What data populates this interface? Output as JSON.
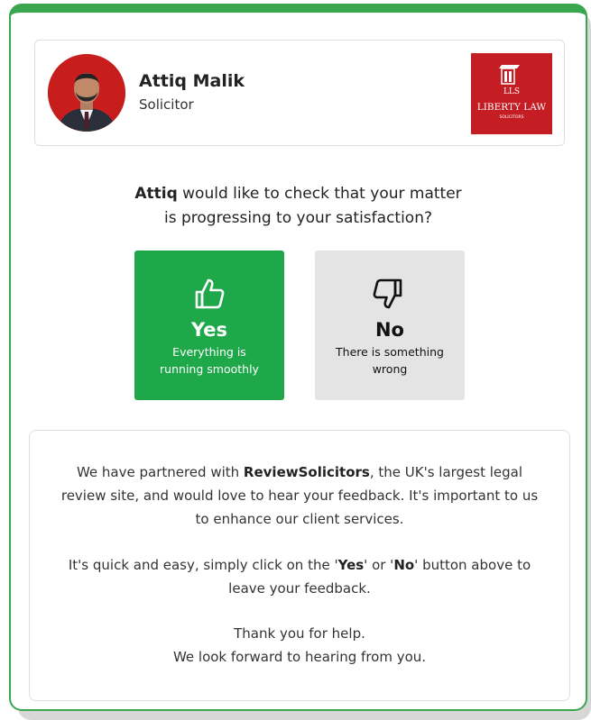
{
  "profile": {
    "name": "Attiq Malik",
    "role": "Solicitor",
    "avatar_icon": "person-photo",
    "logo": {
      "monogram": "LLS",
      "name": "LIBERTY LAW",
      "tagline": "SOLICITORS",
      "background": "#c41d24"
    }
  },
  "question": {
    "first_name": "Attiq",
    "line1_rest": " would like to check that your matter",
    "line2": "is progressing to your satisfaction?"
  },
  "vote_yes": {
    "icon": "thumbs-up-icon",
    "label": "Yes",
    "sub_line1": "Everything is",
    "sub_line2": "running smoothly",
    "color": "#1ea849"
  },
  "vote_no": {
    "icon": "thumbs-down-icon",
    "label": "No",
    "sub_line1": "There is something",
    "sub_line2": "wrong",
    "color": "#e4e4e4"
  },
  "info": {
    "p1_a": "We have partnered with ",
    "p1_brand": "ReviewSolicitors",
    "p1_b": ", the UK's largest legal",
    "p1_line2": "review site, and would love to hear your feedback. It's important to us",
    "p1_line3": "to enhance our client services.",
    "p2_a": "It's quick and easy, simply click on the '",
    "p2_yes": "Yes",
    "p2_mid": "' or '",
    "p2_no": "No",
    "p2_b": "' button above to",
    "p2_line2": "leave your feedback.",
    "p3_line1": "Thank you for help.",
    "p3_line2": "We look forward to hearing from you."
  },
  "accent_color": "#3aa64f"
}
